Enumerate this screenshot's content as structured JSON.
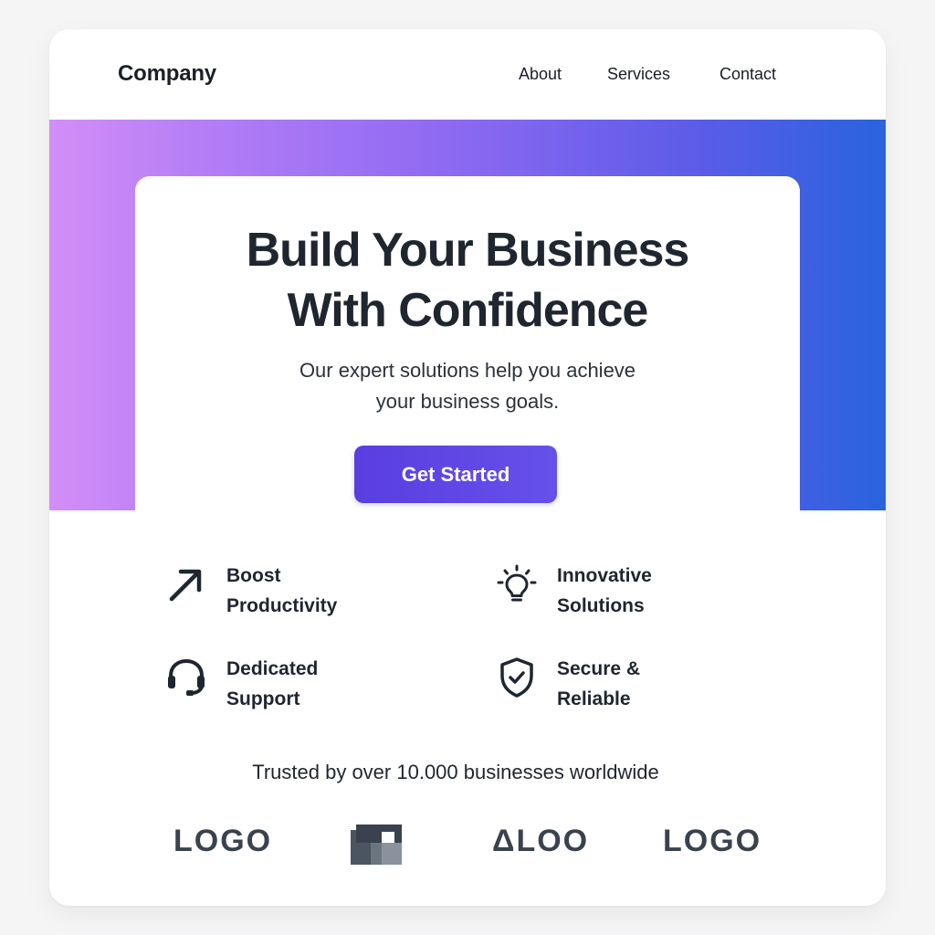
{
  "header": {
    "brand": "Company",
    "nav": [
      {
        "label": "About"
      },
      {
        "label": "Services"
      },
      {
        "label": "Contact"
      }
    ]
  },
  "hero": {
    "title_line1": "Build Your Business",
    "title_line2": "With Confidence",
    "subtitle_line1": "Our expert solutions help you achieve",
    "subtitle_line2": "your business goals.",
    "cta_label": "Get Started"
  },
  "features": [
    {
      "icon": "arrow-up-right-icon",
      "line1": "Boost",
      "line2": "Productivity"
    },
    {
      "icon": "lightbulb-icon",
      "line1": "Innovative",
      "line2": "Solutions"
    },
    {
      "icon": "headset-icon",
      "line1": "Dedicated",
      "line2": "Support"
    },
    {
      "icon": "shield-check-icon",
      "line1": "Secure &",
      "line2": "Reliable"
    }
  ],
  "trusted_text": "Trusted by over 10.000 businesses worldwide",
  "logos": [
    {
      "text": "LOGO"
    },
    {
      "icon": "block-logo-icon"
    },
    {
      "text": "ΔLOO"
    },
    {
      "text": "LOGO"
    }
  ],
  "colors": {
    "gradient_start": "#d28ef7",
    "gradient_end": "#2963dd",
    "cta": "#5a3ee0",
    "text_dark": "#1f2630",
    "logo_gray": "#3a424d"
  }
}
